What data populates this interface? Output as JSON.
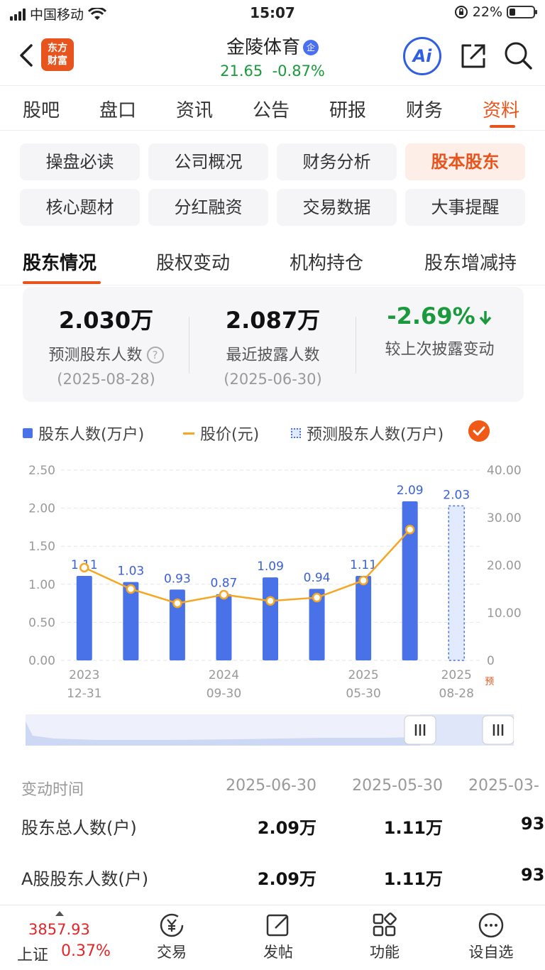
{
  "status": {
    "carrier": "中国移动",
    "time": "15:07",
    "battery": "22%"
  },
  "header": {
    "logo_line1": "东方",
    "logo_line2": "财富",
    "stock_name": "金陵体育",
    "badge": "企",
    "price": "21.65",
    "change": "-0.87%",
    "ai_label": "Ai"
  },
  "main_tabs": [
    "股吧",
    "盘口",
    "资讯",
    "公告",
    "研报",
    "财务",
    "资料"
  ],
  "grid_buttons": [
    "操盘必读",
    "公司概况",
    "财务分析",
    "股本股东",
    "核心题材",
    "分红融资",
    "交易数据",
    "大事提醒"
  ],
  "sub_tabs": [
    "股东情况",
    "股权变动",
    "机构持仓",
    "股东增减持"
  ],
  "summary": [
    {
      "value": "2.030万",
      "label": "预测股东人数",
      "date": "(2025-08-28)"
    },
    {
      "value": "2.087万",
      "label": "最近披露人数",
      "date": "(2025-06-30)"
    },
    {
      "value": "-2.69%",
      "label": "较上次披露变动",
      "date": ""
    }
  ],
  "legend": [
    "股东人数(万户)",
    "股价(元)",
    "预测股东人数(万户)"
  ],
  "chart_data": {
    "type": "bar",
    "series": [
      {
        "name": "股东人数(万户)",
        "type": "bar",
        "values": [
          1.11,
          1.03,
          0.93,
          0.87,
          1.09,
          0.94,
          1.11,
          2.09,
          null
        ]
      },
      {
        "name": "预测股东人数(万户)",
        "type": "bar",
        "values": [
          null,
          null,
          null,
          null,
          null,
          null,
          null,
          null,
          2.03
        ]
      },
      {
        "name": "股价(元)",
        "type": "line",
        "values": [
          19.5,
          15.0,
          12.0,
          13.8,
          12.5,
          13.2,
          16.8,
          27.5,
          null
        ]
      }
    ],
    "data_labels": [
      "1.11",
      "1.03",
      "0.93",
      "0.87",
      "1.09",
      "0.94",
      "1.11",
      "2.09",
      "2.03"
    ],
    "x_ticks": [
      {
        "index": 0,
        "line1": "2023",
        "line2": "12-31"
      },
      {
        "index": 3,
        "line1": "2024",
        "line2": "09-30"
      },
      {
        "index": 6,
        "line1": "2025",
        "line2": "05-30"
      },
      {
        "index": 8,
        "line1": "2025",
        "line2": "08-28"
      }
    ],
    "forecast_mark": "预",
    "y_left": {
      "min": 0,
      "max": 2.5,
      "ticks": [
        "0.00",
        "0.50",
        "1.00",
        "1.50",
        "2.00",
        "2.50"
      ]
    },
    "y_right": {
      "min": 0,
      "max": 40,
      "ticks": [
        "0",
        "10.00",
        "20.00",
        "30.00",
        "40.00"
      ]
    },
    "grid": true,
    "colors": {
      "bar": "#4a72e8",
      "line": "#f5a623",
      "forecast": "#4a72e8"
    }
  },
  "table": {
    "header": [
      "变动时间",
      "2025-06-30",
      "2025-05-30",
      "2025-03-"
    ],
    "rows": [
      {
        "label": "股东总人数(户)",
        "values": [
          "2.09万",
          "1.11万",
          "93"
        ]
      },
      {
        "label": "A股股东人数(户)",
        "values": [
          "2.09万",
          "1.11万",
          "93"
        ]
      }
    ]
  },
  "bottom": {
    "index_value": "3857.93",
    "index_name": "上证",
    "index_change": "0.37%",
    "items": [
      "交易",
      "发帖",
      "功能",
      "设自选"
    ]
  },
  "colors": {
    "accent": "#e8541e",
    "down": "#1a9a3c",
    "up": "#e3262a"
  }
}
